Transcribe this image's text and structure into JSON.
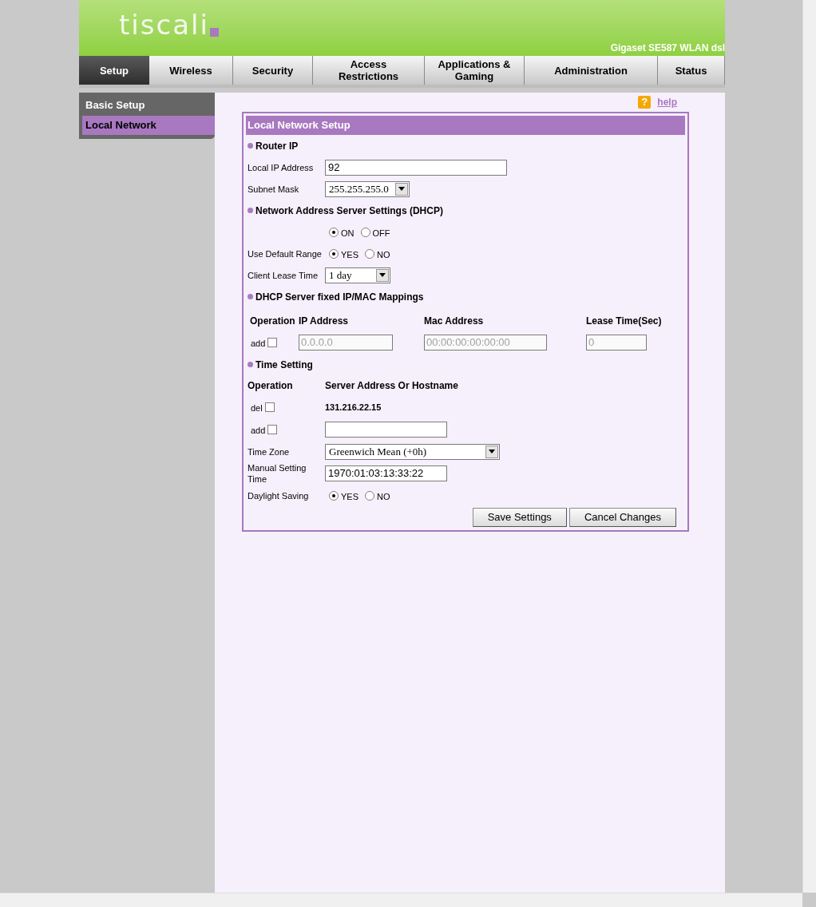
{
  "header": {
    "logo": "tiscali",
    "model": "Gigaset SE587 WLAN dsl"
  },
  "tabs": [
    {
      "label": "Setup",
      "selected": true
    },
    {
      "label": "Wireless",
      "selected": false
    },
    {
      "label": "Security",
      "selected": false
    },
    {
      "label": "Access Restrictions",
      "selected": false
    },
    {
      "label": "Applications & Gaming",
      "selected": false
    },
    {
      "label": "Administration",
      "selected": false
    },
    {
      "label": "Status",
      "selected": false
    }
  ],
  "sidebar": {
    "items": [
      {
        "label": "Basic Setup",
        "selected": false
      },
      {
        "label": "Local Network",
        "selected": true
      }
    ]
  },
  "help": {
    "icon": "?",
    "label": "help"
  },
  "panel": {
    "title": "Local Network Setup",
    "router_ip": {
      "heading": "Router IP",
      "rows": [
        {
          "kind": "text",
          "label": "Local IP Address",
          "value": "92"
        },
        {
          "kind": "select",
          "label": "Subnet Mask",
          "value": "255.255.255.0"
        }
      ]
    },
    "dhcp": {
      "heading": "Network Address Server Settings (DHCP)",
      "rows": [
        {
          "kind": "radio",
          "options": [
            {
              "label": "ON",
              "selected": true
            },
            {
              "label": "OFF",
              "selected": false
            }
          ]
        },
        {
          "kind": "radio",
          "label": "Use Default Range",
          "options": [
            {
              "label": "YES",
              "selected": true
            },
            {
              "label": "NO",
              "selected": false
            }
          ]
        },
        {
          "kind": "select",
          "label": "Client Lease Time",
          "value": "1 day"
        }
      ]
    },
    "mappings": {
      "heading": "DHCP Server fixed IP/MAC Mappings",
      "columns": [
        "Operation",
        "IP Address",
        "Mac Address",
        "Lease Time(Sec)"
      ],
      "row": {
        "operation": "add",
        "checked": false,
        "ip": "0.0.0.0",
        "mac": "00:00:00:00:00:00",
        "lease": "0",
        "disabled": true
      }
    },
    "time": {
      "heading": "Time Setting",
      "columns": [
        "Operation",
        "Server Address Or Hostname"
      ],
      "servers": [
        {
          "operation": "del",
          "checked": false,
          "kind": "static",
          "value": "131.216.22.15"
        },
        {
          "operation": "add",
          "checked": false,
          "kind": "input"
        }
      ],
      "rows": [
        {
          "kind": "select",
          "label": "Time Zone",
          "value": "Greenwich Mean (+0h)"
        },
        {
          "kind": "text",
          "label": "Manual Setting Time",
          "value": "1970:01:03:13:33:22"
        },
        {
          "kind": "radio",
          "label": "Daylight Saving",
          "options": [
            {
              "label": "YES",
              "selected": true
            },
            {
              "label": "NO",
              "selected": false
            }
          ]
        }
      ]
    }
  },
  "buttons": [
    "Save Settings",
    "Cancel Changes"
  ]
}
